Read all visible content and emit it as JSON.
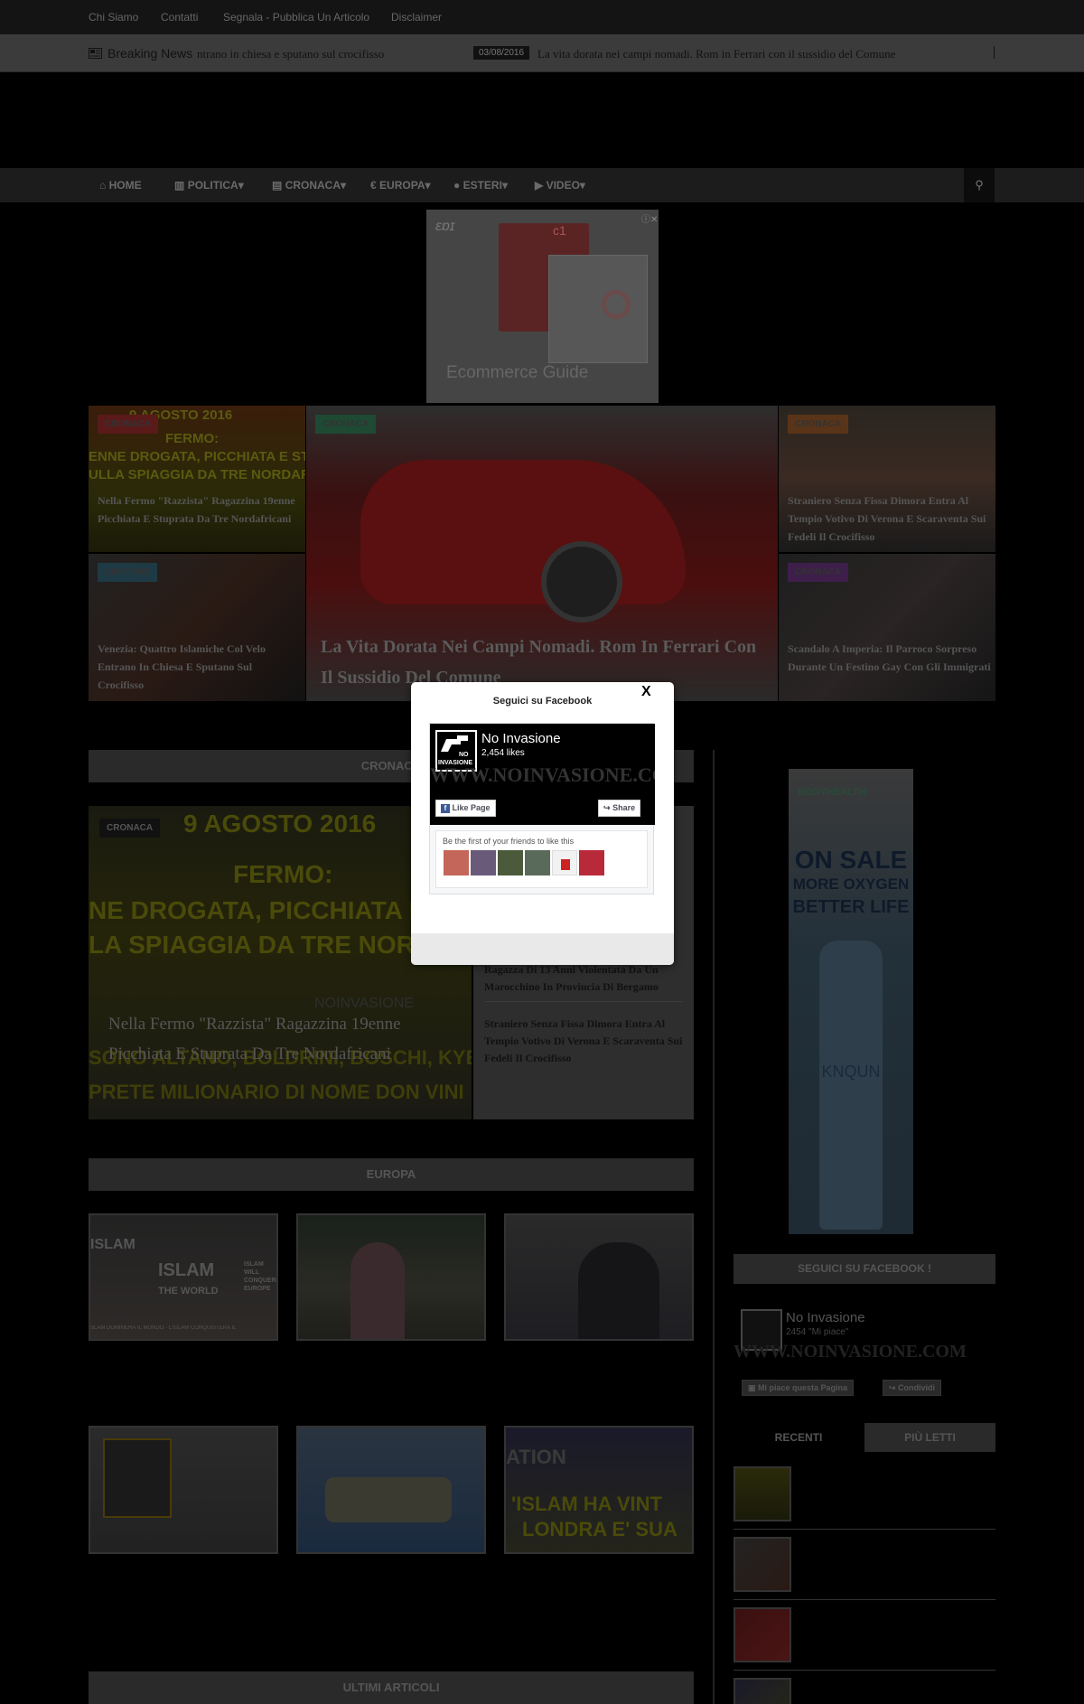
{
  "topbar": {
    "links": [
      "Chi Siamo",
      "Contatti",
      "Segnala - Pubblica Un Articolo",
      "Disclaimer"
    ]
  },
  "breaking": {
    "label": "Breaking News",
    "items": [
      {
        "text": "ntrano in chiesa e sputano sul crocifisso"
      },
      {
        "date": "03/08/2016",
        "text": "La vita dorata nei campi nomadi. Rom in Ferrari con il sussidio del Comune"
      }
    ]
  },
  "nav": {
    "items": [
      {
        "icon": "home-icon",
        "label": "HOME"
      },
      {
        "icon": "bank-icon",
        "label": "POLITICA"
      },
      {
        "icon": "newspaper-icon",
        "label": "CRONACA"
      },
      {
        "icon": "euro-icon",
        "label": "EUROPA"
      },
      {
        "icon": "globe-icon",
        "label": "ESTERI"
      },
      {
        "icon": "video-icon",
        "label": "VIDEO"
      }
    ],
    "dropdown_symbol": "▾"
  },
  "ad_top": {
    "brand": "c1",
    "caption": "Ecommerce Guide"
  },
  "hero": {
    "left_top": {
      "category": "CRONACA",
      "title": "Nella Fermo \"Razzista\" Ragazzina 19enne Picchiata E Stuprata Da Tre Nordafricani",
      "image_text": [
        "9 AGOSTO 2016",
        "FERMO:",
        "ENNE DROGATA, PICCHIATA E STUPRAT",
        "ULLA SPIAGGIA DA TRE NORDAFRICAN"
      ]
    },
    "left_bottom": {
      "category": "CROTONE",
      "title": "Venezia: Quattro Islamiche Col Velo Entrano In Chiesa E Sputano Sul Crocifisso"
    },
    "center": {
      "category": "CRONACA",
      "title": "La Vita Dorata Nei Campi Nomadi. Rom In Ferrari Con Il Sussidio Del Comune"
    },
    "right_top": {
      "category": "CRONACA",
      "title": "Straniero Senza Fissa Dimora Entra Al Tempio Votivo Di Verona E Scaraventa Sui Fedeli Il Crocifisso"
    },
    "right_bottom": {
      "category": "CRONACA",
      "title": "Scandalo A Imperia: Il Parroco Sorpreso Durante Un Festino Gay Con Gli Immigrati"
    }
  },
  "cronaca_section": {
    "header": "CRONACA",
    "featured": {
      "category": "CRONACA",
      "title": "Nella Fermo \"Razzista\" Ragazzina 19enne Picchiata E Stuprata Da Tre Nordafricani",
      "image_text": [
        "9 AGOSTO 2016",
        "FERMO:",
        "NE DROGATA, PICCHIATA E S",
        "LA SPIAGGIA DA TRE NORDA",
        "NOINVASIONE",
        "SONO ALTANO, BOLDRINI, BOSCHI, KYE",
        "PRETE MILIONARIO DI NOME DON VINI"
      ]
    },
    "list": [
      "Ragazza Di 13 Anni Violentata Da Un Marocchino In Provincia Di Bergamo",
      "Straniero Senza Fissa Dimora Entra Al Tempio Votivo Di Verona E Scaraventa Sui Fedeli Il Crocifisso"
    ]
  },
  "europa_section": {
    "header": "EUROPA",
    "thumb_texts": [
      "ISLAM",
      "ISLAM",
      "THE WORLD",
      "SLAM DOMINERÀ IL MONDO - L'ISLAM CONQUISTERÀ IL",
      "ISLAM WILL CONQUER EUROPE",
      "ATION",
      "'ISLAM HA VINT",
      "LONDRA E' SUA"
    ]
  },
  "ultimi_section": {
    "header": "ULTIMI ARTICOLI"
  },
  "sidebar": {
    "ad": {
      "brand": "BODYHEALTH",
      "headline": [
        "ON SALE",
        "MORE OXYGEN",
        "BETTER LIFE"
      ],
      "product": "KNQUN"
    },
    "fb_widget": {
      "header": "SEGUICI SU FACEBOOK !",
      "page_name": "No Invasione",
      "likes": "2454 \"Mi piace\"",
      "banner": "WWW.NOINVASIONE.COM",
      "like_button": "Mi piace questa Pagina",
      "share_button": "Condividi"
    },
    "tabs": [
      "RECENTI",
      "PIÙ LETTI"
    ]
  },
  "modal": {
    "title": "Seguici su Facebook",
    "close": "X",
    "page_name": "No Invasione",
    "likes": "2,454 likes",
    "banner": "WWW.NOINVASIONE.COM",
    "logo_text": [
      "NO",
      "INVASIONE"
    ],
    "like_button": "Like Page",
    "share_button": "Share",
    "friends_text": "Be the first of your friends to like this"
  },
  "colors": {
    "cronaca": "#8a3030",
    "crotone": "#2a5a6a",
    "center_cat": "#2a6a4a",
    "right_top_cat": "#8a4a2a",
    "right_bottom_cat": "#5a2a6a",
    "facebook": "#3b5998"
  }
}
